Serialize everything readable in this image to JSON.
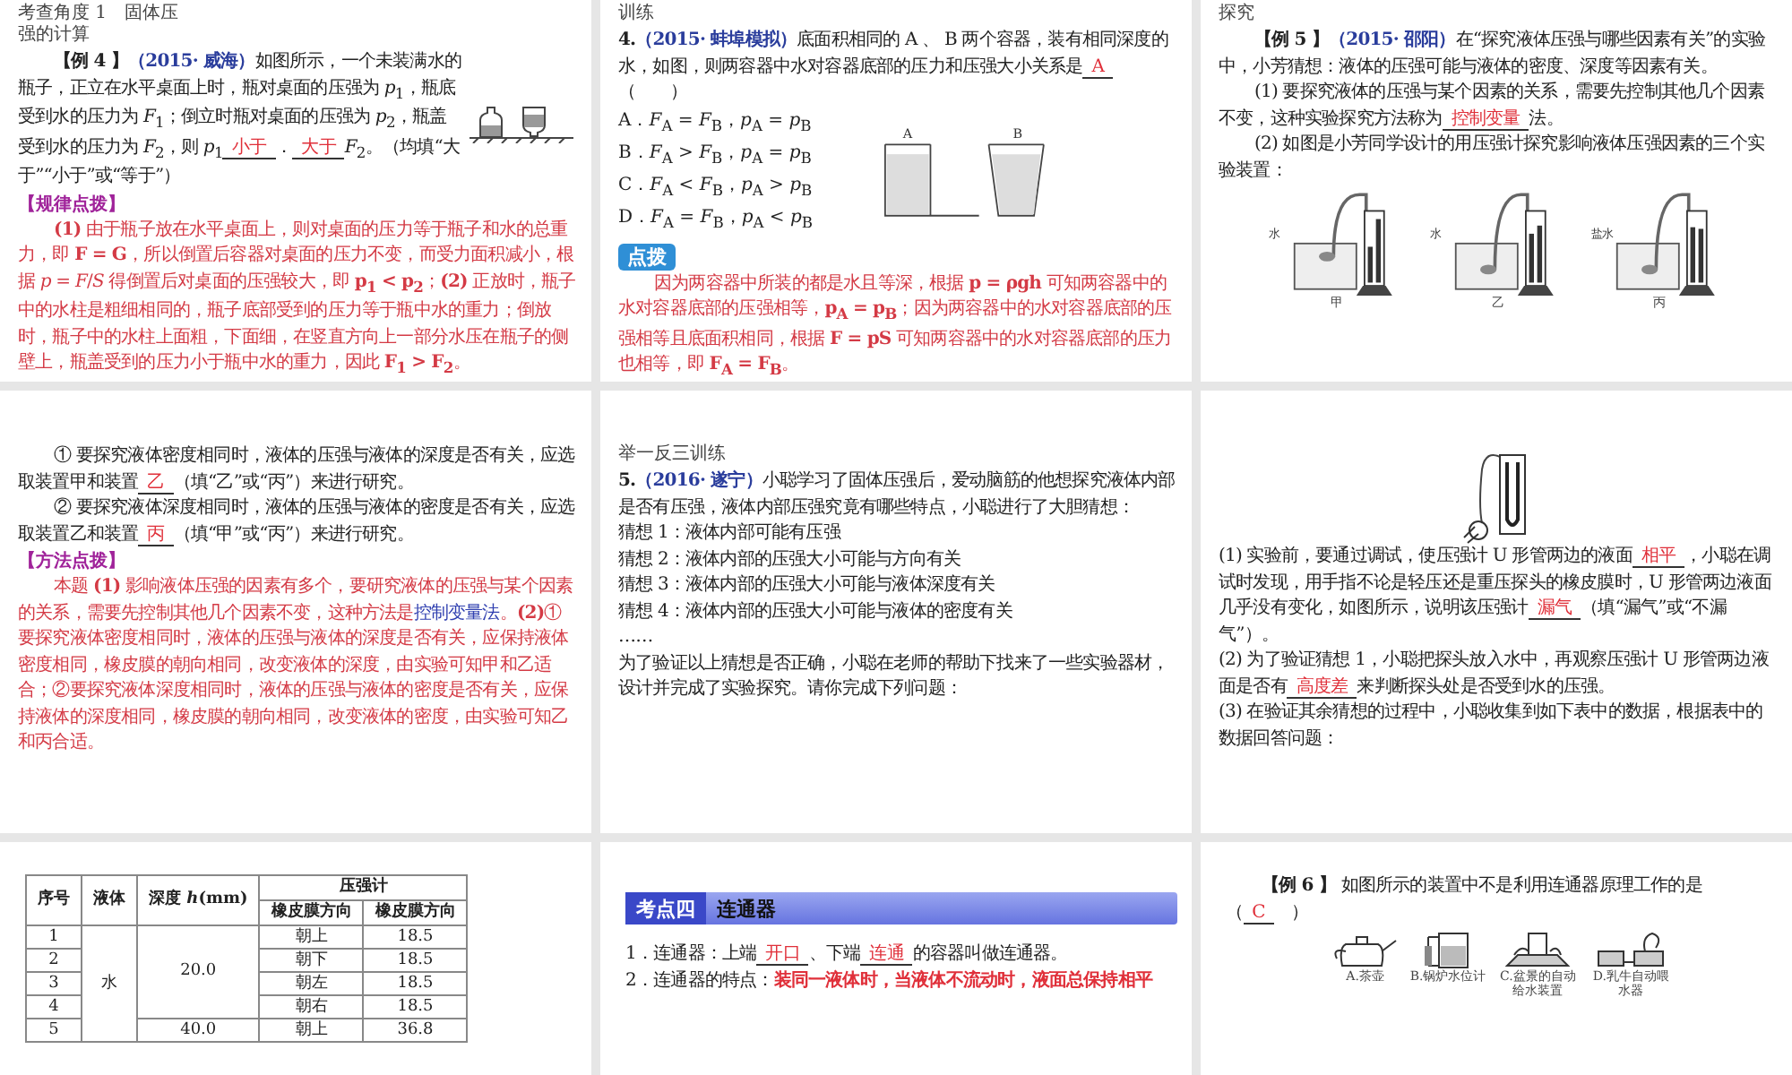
{
  "slides": [
    {
      "blocks": [
        {
          "kind": "title",
          "text": "考查角度 1　固体压强的计算"
        },
        {
          "kind": "bottles"
        },
        {
          "kind": "question",
          "indent": true,
          "parts": [
            {
              "kind": "text",
              "t": "**【例 4 】**"
            },
            {
              "kind": "source",
              "t": "（2015· 威海）"
            },
            {
              "kind": "text",
              "t": "如图所示，一个未装满水的瓶子，正立在水平桌面上时，瓶对桌面的压强为 *p*$_{1}$，瓶底受到水的压力为 *F*$_{1}$；倒立时瓶对桌面的压强为 *p*$_{2}$，瓶盖受到水的压力为 *F*$_{2}$，则 *p*$_{1}$"
            },
            {
              "kind": "answer",
              "t": "小于"
            },
            {
              "kind": "text",
              "t": "．"
            },
            {
              "kind": "answer",
              "t": "大于"
            },
            {
              "kind": "text",
              "t": "*F*$_{2}$。（均填“大于”“小于”或“等于”）"
            }
          ]
        },
        {
          "kind": "tag",
          "text": "【规律点拨】"
        },
        {
          "kind": "explain",
          "indent": true,
          "parts": [
            {
              "kind": "text",
              "t": "**(1)** 由于瓶子放在水平桌面上，则对桌面的压力等于瓶子和水的总重力，即 **F = G**，所以倒置后容器对桌面的压力不变，而受力面积减小，根据 *p* = *F*/*S* 得倒置后对桌面的压强较大，即 **p$_{1}$ < p$_{2}$**；**(2)** 正放时，瓶子中的水柱是粗细相同的，瓶子底部受到的压力等于瓶中水的重力；倒放时，瓶子中的水柱上面粗，下面细，在竖直方向上一部分水压在瓶子的侧壁上，瓶盖受到的压力小于瓶中水的重力，因此 **F$_{1}$ > F$_{2}$**。"
            }
          ]
        }
      ]
    },
    {
      "blocks": [
        {
          "kind": "title",
          "text": "训练"
        },
        {
          "kind": "question",
          "indent": false,
          "parts": [
            {
              "kind": "text",
              "t": "**4.**"
            },
            {
              "kind": "source",
              "t": "（2015· 蚌埠模拟）"
            },
            {
              "kind": "text",
              "t": "底面积相同的 A 、 B 两个容器，装有相同深度的水，如图，则两容器中水对容器底部的压力和压强大小关系是"
            },
            {
              "kind": "answer",
              "t": "A"
            },
            {
              "kind": "text",
              "t": "（　　）"
            }
          ]
        },
        {
          "kind": "split",
          "figure": {
            "kind": "containers",
            "labels": [
              "A",
              "B"
            ]
          },
          "options": [
            "A．*F*$_{A}$ = *F*$_{B}$，*p*$_{A}$ = *p*$_{B}$",
            "B．*F*$_{A}$ > *F*$_{B}$，*p*$_{A}$ = *p*$_{B}$",
            "C．*F*$_{A}$ < *F*$_{B}$，*p*$_{A}$ > *p*$_{B}$",
            "D．*F*$_{A}$ = *F*$_{B}$，*p*$_{A}$ < *p*$_{B}$"
          ]
        },
        {
          "kind": "badge",
          "text": "点拨"
        },
        {
          "kind": "explain",
          "indent": true,
          "parts": [
            {
              "kind": "text",
              "t": "因为两容器中所装的都是水且等深，根据 **p = ρgh** 可知两容器中的水对容器底部的压强相等，**p$_{A}$ = p$_{B}$**；因为两容器中的水对容器底部的压强相等且底面积相同，根据 **F = pS** 可知两容器中的水对容器底部的压力也相等，即 **F$_{A}$ = F$_{B}$**。"
            }
          ]
        }
      ]
    },
    {
      "blocks": [
        {
          "kind": "title",
          "text": "探究"
        },
        {
          "kind": "question",
          "indent": true,
          "parts": [
            {
              "kind": "text",
              "t": "**【例 5 】**"
            },
            {
              "kind": "source",
              "t": "（2015· 邵阳）"
            },
            {
              "kind": "text",
              "t": "在“探究液体压强与哪些因素有关”的实验中，小芳猜想：液体的压强可能与液体的密度、深度等因素有关。"
            }
          ]
        },
        {
          "kind": "question",
          "indent": true,
          "parts": [
            {
              "kind": "text",
              "t": "(1) 要探究液体的压强与某个因素的关系，需要先控制其他几个因素不变，这种实验探究方法称为"
            },
            {
              "kind": "answer",
              "t": "控制变量"
            },
            {
              "kind": "text",
              "t": "法。"
            }
          ]
        },
        {
          "kind": "question",
          "indent": true,
          "parts": [
            {
              "kind": "text",
              "t": "(2) 如图是小芳同学设计的用压强计探究影响液体压强因素的三个实验装置："
            }
          ]
        },
        {
          "kind": "manometers",
          "items": [
            {
              "caption": "甲",
              "liquid": "水"
            },
            {
              "caption": "乙",
              "liquid": "水"
            },
            {
              "caption": "丙",
              "liquid": "盐水"
            }
          ]
        }
      ]
    },
    {
      "blocks": [
        {
          "kind": "question",
          "indent": true,
          "parts": [
            {
              "kind": "text",
              "t": "① 要探究液体密度相同时，液体的压强与液体的深度是否有关，应选取装置甲和装置"
            },
            {
              "kind": "answer",
              "t": "乙"
            },
            {
              "kind": "text",
              "t": "（填“乙”或“丙”）来进行研究。"
            }
          ]
        },
        {
          "kind": "question",
          "indent": true,
          "parts": [
            {
              "kind": "text",
              "t": "② 要探究液体深度相同时，液体的压强与液体的密度是否有关，应选取装置乙和装置"
            },
            {
              "kind": "answer",
              "t": "丙"
            },
            {
              "kind": "text",
              "t": "（填“甲”或“丙”）来进行研究。"
            }
          ]
        },
        {
          "kind": "tag",
          "text": "【方法点拨】"
        },
        {
          "kind": "explain",
          "indent": true,
          "parts": [
            {
              "kind": "text",
              "t": "本题 **(1)** 影响液体压强的因素有多个，要研究液体的压强与某个因素的关系，需要先控制其他几个因素不变，这种方法是"
            },
            {
              "kind": "term",
              "t": "控制变量法"
            },
            {
              "kind": "text",
              "t": "。**(2)**① 要探究液体密度相同时，液体的压强与液体的深度是否有关，应保持液体密度相同，橡皮膜的朝向相同，改变液体的深度，由实验可知甲和乙适合；②要探究液体深度相同时，液体的压强与液体的密度是否有关，应保持液体的深度相同，橡皮膜的朝向相同，改变液体的密度，由实验可知乙和丙合适。"
            }
          ]
        }
      ]
    },
    {
      "blocks": [
        {
          "kind": "title",
          "text": "举一反三训练"
        },
        {
          "kind": "question",
          "indent": false,
          "parts": [
            {
              "kind": "text",
              "t": "**5.**"
            },
            {
              "kind": "source",
              "t": "（2016· 遂宁）"
            },
            {
              "kind": "text",
              "t": "小聪学习了固体压强后，爱动脑筋的他想探究液体内部是否有压强，液体内部压强究竟有哪些特点，小聪进行了大胆猜想："
            }
          ]
        },
        {
          "kind": "question",
          "indent": false,
          "parts": [
            {
              "kind": "text",
              "t": "猜想 1：液体内部可能有压强"
            }
          ]
        },
        {
          "kind": "question",
          "indent": false,
          "parts": [
            {
              "kind": "text",
              "t": "猜想 2：液体内部的压强大小可能与方向有关"
            }
          ]
        },
        {
          "kind": "question",
          "indent": false,
          "parts": [
            {
              "kind": "text",
              "t": "猜想 3：液体内部的压强大小可能与液体深度有关"
            }
          ]
        },
        {
          "kind": "question",
          "indent": false,
          "parts": [
            {
              "kind": "text",
              "t": "猜想 4：液体内部的压强大小可能与液体的密度有关"
            }
          ]
        },
        {
          "kind": "question",
          "indent": false,
          "parts": [
            {
              "kind": "text",
              "t": "……"
            }
          ]
        },
        {
          "kind": "question",
          "indent": false,
          "parts": [
            {
              "kind": "text",
              "t": "为了验证以上猜想是否正确，小聪在老师的帮助下找来了一些实验器材，设计并完成了实验探究。请你完成下列问题："
            }
          ]
        }
      ]
    },
    {
      "blocks": [
        {
          "kind": "probe"
        },
        {
          "kind": "question",
          "indent": false,
          "parts": [
            {
              "kind": "text",
              "t": "(1) 实验前，要通过调试，使压强计 U 形管两边的液面"
            },
            {
              "kind": "answer",
              "t": "相平"
            },
            {
              "kind": "text",
              "t": "，小聪在调试时发现，用手指不论是轻压还是重压探头的橡皮膜时，U 形管两边液面几乎没有变化，如图所示，说明该压强计"
            },
            {
              "kind": "answer",
              "t": "漏气"
            },
            {
              "kind": "text",
              "t": "（填“漏气”或“不漏气”）。"
            }
          ]
        },
        {
          "kind": "question",
          "indent": false,
          "parts": [
            {
              "kind": "text",
              "t": "(2) 为了验证猜想 1，小聪把探头放入水中，再观察压强计 U 形管两边液面是否有"
            },
            {
              "kind": "answer",
              "t": "高度差"
            },
            {
              "kind": "text",
              "t": "来判断探头处是否受到水的压强。"
            }
          ]
        },
        {
          "kind": "question",
          "indent": false,
          "parts": [
            {
              "kind": "text",
              "t": "(3) 在验证其余猜想的过程中，小聪收集到如下表中的数据，根据表中的数据回答问题："
            }
          ]
        }
      ]
    },
    {
      "blocks": [
        {
          "kind": "table",
          "head": [
            "序号",
            "液体",
            "深度 *h*(mm)",
            "压强计"
          ],
          "subhead": [
            "橡皮膜方向",
            "橡皮膜方向"
          ],
          "liquid": "水",
          "depth": "20.0",
          "rows": [
            {
              "no": "1",
              "dir": "朝上",
              "val": "18.5"
            },
            {
              "no": "2",
              "dir": "朝下",
              "val": "18.5"
            },
            {
              "no": "3",
              "dir": "朝左",
              "val": "18.5"
            },
            {
              "no": "4",
              "dir": "朝右",
              "val": "18.5"
            }
          ],
          "row5": {
            "no": "5",
            "depth": "40.0",
            "dir": "朝上",
            "val": "36.8"
          }
        }
      ]
    },
    {
      "blocks": [
        {
          "kind": "header",
          "tag": "考点四",
          "title": "连通器"
        },
        {
          "kind": "question",
          "indent": false,
          "parts": [
            {
              "kind": "text",
              "t": "1．连通器：上端"
            },
            {
              "kind": "answer",
              "t": "开口"
            },
            {
              "kind": "text",
              "t": "、下端"
            },
            {
              "kind": "answer",
              "t": "连通"
            },
            {
              "kind": "text",
              "t": "的容器叫做连通器。"
            }
          ]
        },
        {
          "kind": "question",
          "indent": false,
          "parts": [
            {
              "kind": "text",
              "t": "2．连通器的特点："
            },
            {
              "kind": "statement",
              "t": "装同一液体时，当液体不流动时，液面总保持相平"
            }
          ]
        }
      ]
    },
    {
      "blocks": [
        {
          "kind": "question",
          "indent": true,
          "parts": [
            {
              "kind": "text",
              "t": "**【例 6 】** 如图所示的装置中不是利用连通器原理工作的是（"
            },
            {
              "kind": "answer",
              "t": "C"
            },
            {
              "kind": "text",
              "t": "　）"
            }
          ]
        },
        {
          "kind": "devices",
          "captions": [
            "A.茶壶",
            "B.锅炉水位计",
            "C.盆景的自动给水装置",
            "D.乳牛自动喂水器"
          ]
        }
      ]
    }
  ]
}
